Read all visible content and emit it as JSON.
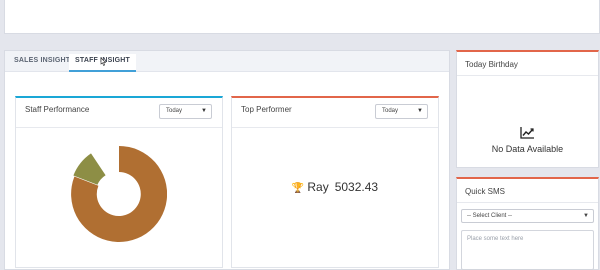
{
  "tabs": [
    {
      "label": "SALES INSIGHT"
    },
    {
      "label": "STAFF INSIGHT"
    }
  ],
  "staff_performance": {
    "title": "Staff Performance",
    "period": "Today",
    "colors": [
      "#b06f32",
      "#8d8e45"
    ]
  },
  "top_performer": {
    "title": "Top Performer",
    "period": "Today",
    "name": "Ray",
    "value": "5032.43",
    "icon": "trophy-icon"
  },
  "birthday": {
    "title": "Today Birthday",
    "empty_text": "No Data Available",
    "icon": "chart-line-icon"
  },
  "quick_sms": {
    "title": "Quick SMS",
    "client_select": "-- Select Client --",
    "message_placeholder": "Place some text here"
  }
}
